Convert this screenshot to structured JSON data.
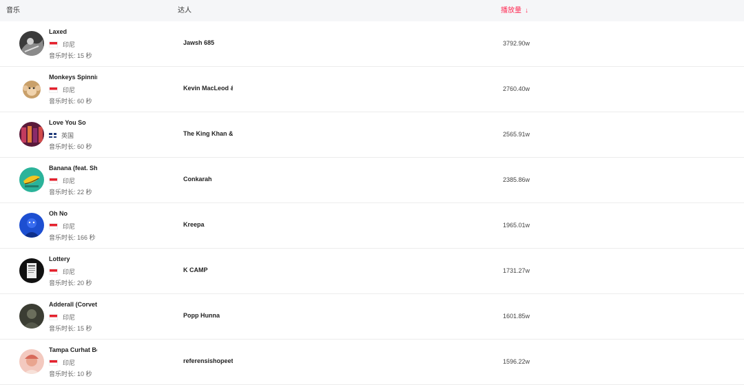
{
  "header": {
    "music_label": "音乐",
    "artist_label": "达人",
    "plays_label": "播放量",
    "sort_icon": "arrow-down-icon",
    "accent_color": "#fe2c55"
  },
  "rows": [
    {
      "title": "Laxed",
      "region": "印尼",
      "flag": "indonesia-flag-icon",
      "duration": "音乐时长: 15 秒",
      "artist": "Jawsh 685",
      "plays": "3792.90w"
    },
    {
      "title": "Monkeys Spinning",
      "region": "印尼",
      "flag": "indonesia-flag-icon",
      "duration": "音乐时长: 60 秒",
      "artist": "Kevin MacLeod &",
      "plays": "2760.40w"
    },
    {
      "title": "Love You So",
      "region": "英国",
      "flag": "uk-flag-icon",
      "duration": "音乐时长: 60 秒",
      "artist": "The King Khan &",
      "plays": "2565.91w"
    },
    {
      "title": "Banana (feat. Sha",
      "region": "印尼",
      "flag": "indonesia-flag-icon",
      "duration": "音乐时长: 22 秒",
      "artist": "Conkarah",
      "plays": "2385.86w"
    },
    {
      "title": "Oh No",
      "region": "印尼",
      "flag": "indonesia-flag-icon",
      "duration": "音乐时长: 166 秒",
      "artist": "Kreepa",
      "plays": "1965.01w"
    },
    {
      "title": "Lottery",
      "region": "印尼",
      "flag": "indonesia-flag-icon",
      "duration": "音乐时长: 20 秒",
      "artist": "K CAMP",
      "plays": "1731.27w"
    },
    {
      "title": "Adderall (Corvett",
      "region": "印尼",
      "flag": "indonesia-flag-icon",
      "duration": "音乐时长: 15 秒",
      "artist": "Popp Hunna",
      "plays": "1601.85w"
    },
    {
      "title": "Tampa Curhat Be",
      "region": "印尼",
      "flag": "indonesia-flag-icon",
      "duration": "音乐时长: 10 秒",
      "artist": "referensishopeetc",
      "plays": "1596.22w"
    }
  ]
}
